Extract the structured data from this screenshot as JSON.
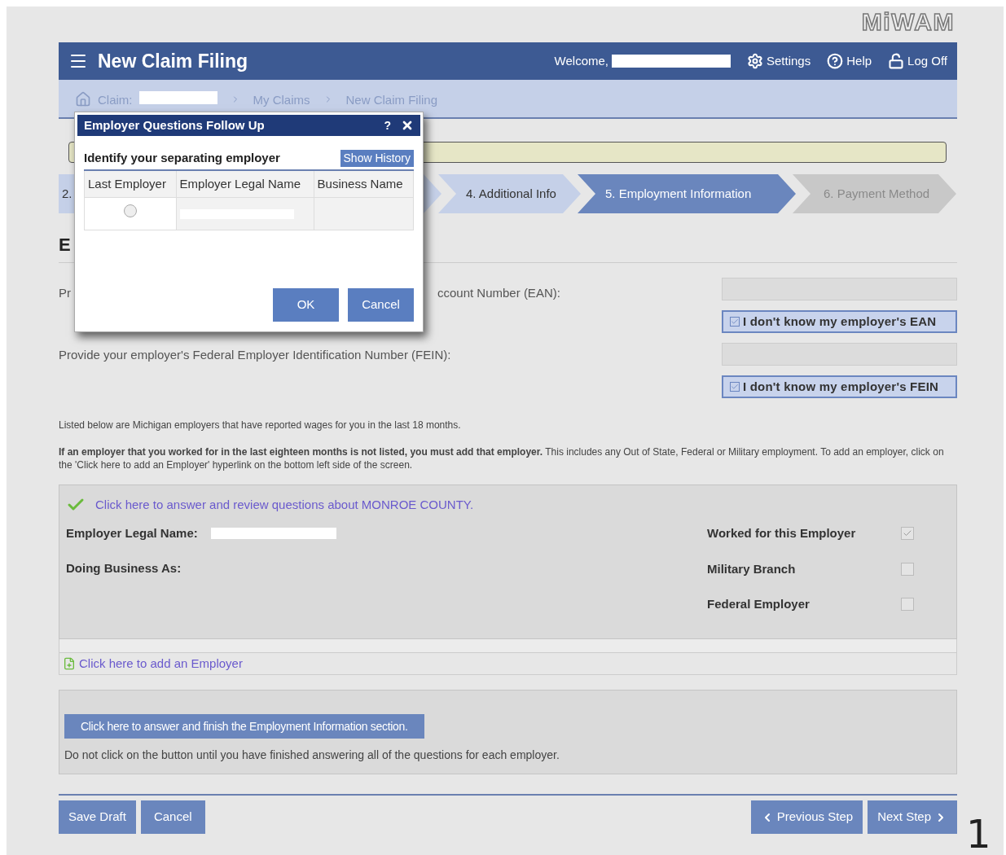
{
  "logo": "MiWAM",
  "header": {
    "title": "New Claim Filing",
    "welcome": "Welcome,",
    "links": [
      {
        "kind": "settings",
        "label": "Settings"
      },
      {
        "kind": "help",
        "label": "Help"
      },
      {
        "kind": "logoff",
        "label": "Log Off"
      }
    ]
  },
  "breadcrumb": [
    "Claim:",
    "My Claims",
    "New Claim Filing"
  ],
  "steps": [
    {
      "label": "2.",
      "selected": false,
      "disabled": false
    },
    {
      "label": "4. Additional Info",
      "selected": false,
      "disabled": false
    },
    {
      "label": "5. Employment Information",
      "selected": true,
      "disabled": false
    },
    {
      "label": "6. Payment Method",
      "selected": false,
      "disabled": true
    }
  ],
  "section_heading": "E",
  "ean": {
    "label_start": "Pr",
    "label_end": "ccount Number (EAN):",
    "checkbox": {
      "label": "I don't know my employer's EAN",
      "checked": true
    }
  },
  "fein": {
    "label": "Provide your employer's Federal Employer Identification Number (FEIN):",
    "checkbox": {
      "label": "I don't know my employer's FEIN",
      "checked": true
    }
  },
  "note": "Listed below are Michigan employers that have reported wages for you in the last 18 months.",
  "notice": "**If an employer that you worked for in the last eighteen months is not listed, you must add that employer.** This includes any Out of State, Federal or Military employment. To add an employer, click on the 'Click here to add an Employer' hyperlink on the bottom left side of the screen.",
  "employer": {
    "link": "Click here to answer and review questions about MONROE COUNTY.",
    "legal_name_label": "Employer Legal Name:",
    "dba_label": "Doing Business As:",
    "flags": [
      {
        "label": "Worked for this Employer",
        "checked": true
      },
      {
        "label": "Military Branch",
        "checked": false
      },
      {
        "label": "Federal Employer",
        "checked": false
      }
    ]
  },
  "add_employer_link": "Click here to add an Employer",
  "finish": {
    "button": "Click here to answer and finish the Employment Information section.",
    "note": "Do not click on the button until you have finished answering all of the questions for each employer."
  },
  "footer": {
    "save": "Save Draft",
    "cancel": "Cancel",
    "previous": "Previous Step",
    "next": "Next Step"
  },
  "dialog": {
    "title": "Employer Questions Follow Up",
    "help": "?",
    "heading": "Identify your separating employer",
    "show_history": "Show History",
    "columns": [
      "Last Employer",
      "Employer Legal Name",
      "Business Name"
    ],
    "rows": [
      {
        "selected": false
      }
    ],
    "ok": "OK",
    "cancel": "Cancel"
  },
  "page_number": "1"
}
